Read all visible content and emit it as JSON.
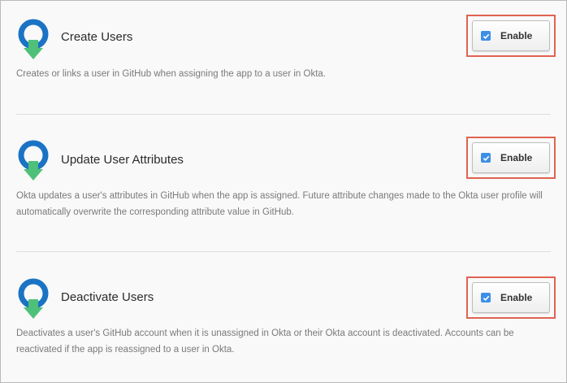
{
  "icon": {
    "name": "provisioning-icon",
    "ring_color": "#1a73c4",
    "arrow_color": "#4fc07a"
  },
  "sections": [
    {
      "title": "Create Users",
      "description": "Creates or links a user in GitHub when assigning the app to a user in Okta.",
      "enable_label": "Enable",
      "enabled": true
    },
    {
      "title": "Update User Attributes",
      "description": "Okta updates a user's attributes in GitHub when the app is assigned. Future attribute changes made to the Okta user profile will automatically overwrite the corresponding attribute value in GitHub.",
      "enable_label": "Enable",
      "enabled": true
    },
    {
      "title": "Deactivate Users",
      "description": "Deactivates a user's GitHub account when it is unassigned in Okta or their Okta account is deactivated. Accounts can be reactivated if the app is reassigned to a user in Okta.",
      "enable_label": "Enable",
      "enabled": true
    }
  ],
  "colors": {
    "highlight_border": "#e06352",
    "checkbox_checked": "#3d8fe6"
  }
}
